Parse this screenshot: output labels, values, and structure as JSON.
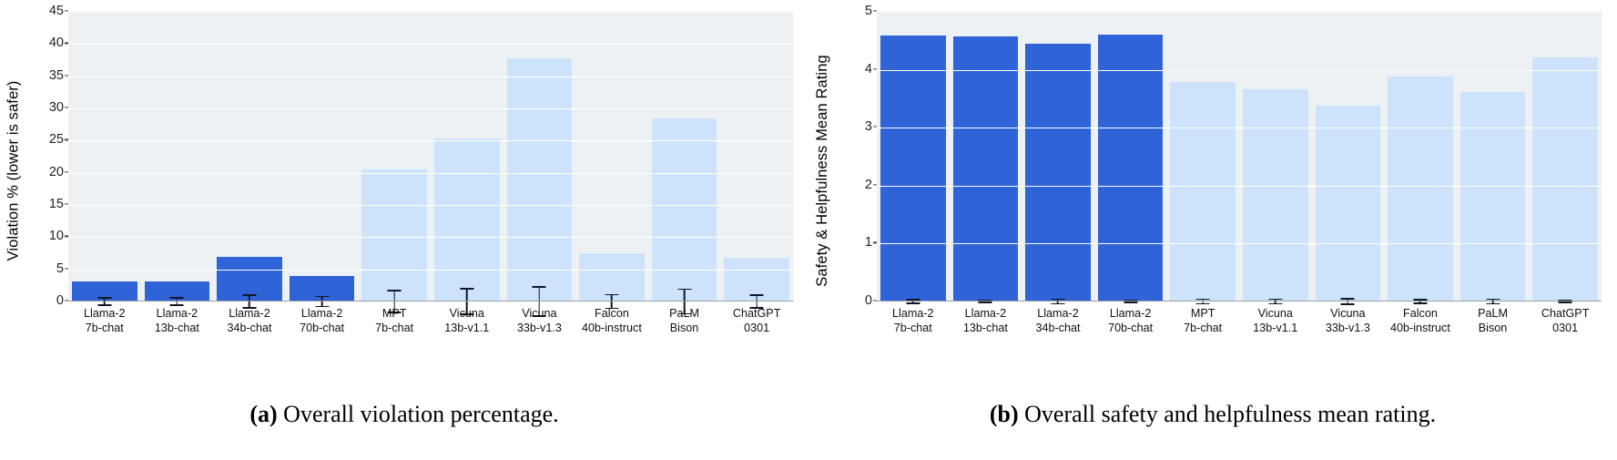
{
  "figure": {
    "panels": [
      {
        "id": "panel-a",
        "caption_tag": "(a)",
        "caption_text": " Overall violation percentage.",
        "ylabel": "Violation % (lower is safer)",
        "yticks": [
          "0",
          "5",
          "10",
          "15",
          "20",
          "25",
          "30",
          "35",
          "40",
          "45"
        ]
      },
      {
        "id": "panel-b",
        "caption_tag": "(b)",
        "caption_text": " Overall safety and helpfulness mean rating.",
        "ylabel": "Safety & Helpfulness Mean Rating",
        "yticks": [
          "0",
          "1",
          "2",
          "3",
          "4",
          "5"
        ]
      }
    ]
  },
  "chart_data": [
    {
      "type": "bar",
      "title": "Overall violation percentage.",
      "xlabel": "",
      "ylabel": "Violation % (lower is safer)",
      "ylim": [
        0,
        45
      ],
      "ytick_step": 5,
      "grid": true,
      "legend": "none",
      "colors": {
        "highlight": "#2f63d8",
        "other": "#cce3fb",
        "error_bar": "#101828",
        "plot_background": "#eef1f4",
        "gridline": "#ffffff"
      },
      "categories": [
        "Llama-2\n7b-chat",
        "Llama-2\n13b-chat",
        "Llama-2\n34b-chat",
        "Llama-2\n70b-chat",
        "MPT\n7b-chat",
        "Vicuna\n13b-v1.1",
        "Vicuna\n33b-v1.3",
        "Falcon\n40b-instruct",
        "PaLM\nBison",
        "ChatGPT\n0301"
      ],
      "category_lines": [
        [
          "Llama-2",
          "7b-chat"
        ],
        [
          "Llama-2",
          "13b-chat"
        ],
        [
          "Llama-2",
          "34b-chat"
        ],
        [
          "Llama-2",
          "70b-chat"
        ],
        [
          "MPT",
          "7b-chat"
        ],
        [
          "Vicuna",
          "13b-v1.1"
        ],
        [
          "Vicuna",
          "33b-v1.3"
        ],
        [
          "Falcon",
          "40b-instruct"
        ],
        [
          "PaLM",
          "Bison"
        ],
        [
          "ChatGPT",
          "0301"
        ]
      ],
      "values": [
        3.1,
        3.1,
        6.9,
        3.9,
        20.5,
        25.3,
        37.8,
        7.5,
        28.5,
        6.8
      ],
      "errors": [
        0.7,
        0.7,
        1.1,
        0.9,
        1.8,
        2.1,
        2.4,
        1.2,
        2.0,
        1.1
      ],
      "highlighted": [
        true,
        true,
        true,
        true,
        false,
        false,
        false,
        false,
        false,
        false
      ]
    },
    {
      "type": "bar",
      "title": "Overall safety and helpfulness mean rating.",
      "xlabel": "",
      "ylabel": "Safety & Helpfulness Mean Rating",
      "ylim": [
        0,
        5
      ],
      "ytick_step": 1,
      "grid": true,
      "legend": "none",
      "colors": {
        "highlight": "#2f63d8",
        "other": "#cce3fb",
        "error_bar": "#101828",
        "plot_background": "#eef1f4",
        "gridline": "#ffffff"
      },
      "categories": [
        "Llama-2\n7b-chat",
        "Llama-2\n13b-chat",
        "Llama-2\n34b-chat",
        "Llama-2\n70b-chat",
        "MPT\n7b-chat",
        "Vicuna\n13b-v1.1",
        "Vicuna\n33b-v1.3",
        "Falcon\n40b-instruct",
        "PaLM\nBison",
        "ChatGPT\n0301"
      ],
      "category_lines": [
        [
          "Llama-2",
          "7b-chat"
        ],
        [
          "Llama-2",
          "13b-chat"
        ],
        [
          "Llama-2",
          "34b-chat"
        ],
        [
          "Llama-2",
          "70b-chat"
        ],
        [
          "MPT",
          "7b-chat"
        ],
        [
          "Vicuna",
          "13b-v1.1"
        ],
        [
          "Vicuna",
          "33b-v1.3"
        ],
        [
          "Falcon",
          "40b-instruct"
        ],
        [
          "PaLM",
          "Bison"
        ],
        [
          "ChatGPT",
          "0301"
        ]
      ],
      "values": [
        4.59,
        4.58,
        4.45,
        4.6,
        3.79,
        3.67,
        3.38,
        3.88,
        3.61,
        4.22
      ],
      "errors": [
        0.04,
        0.03,
        0.05,
        0.03,
        0.05,
        0.05,
        0.06,
        0.04,
        0.05,
        0.03
      ],
      "highlighted": [
        true,
        true,
        true,
        true,
        false,
        false,
        false,
        false,
        false,
        false
      ]
    }
  ]
}
